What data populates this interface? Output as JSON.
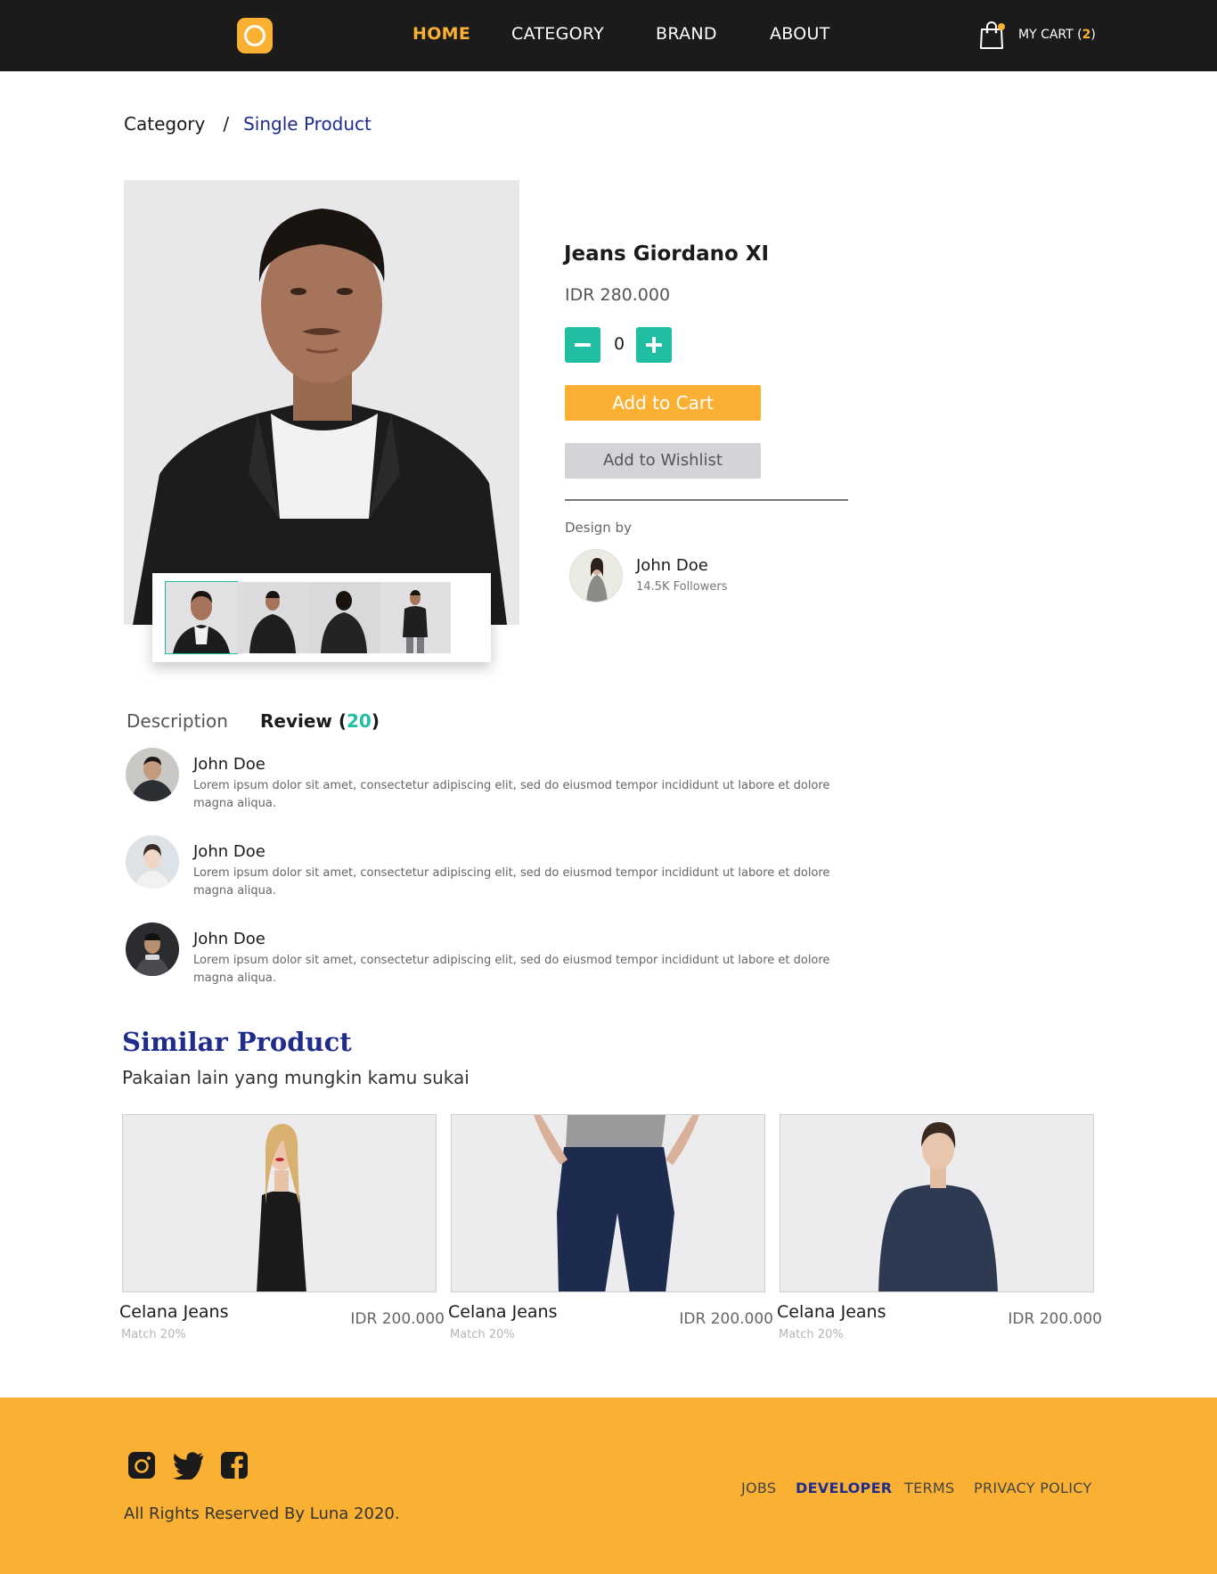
{
  "header": {
    "logo_icon": "ring-logo-icon",
    "nav": [
      {
        "label": "HOME",
        "active": true
      },
      {
        "label": "CATEGORY",
        "active": false
      },
      {
        "label": "BRAND",
        "active": false
      },
      {
        "label": "ABOUT",
        "active": false
      }
    ],
    "cart": {
      "label": "MY CART (",
      "count": "2",
      "close": ")",
      "icon": "shopping-bag-icon"
    }
  },
  "breadcrumb": {
    "parent": "Category",
    "separator": "/",
    "current": "Single Product"
  },
  "product": {
    "title": "Jeans Giordano XI",
    "price": "IDR 280.000",
    "quantity": "0",
    "minus_icon": "minus-icon",
    "plus_icon": "plus-icon",
    "add_to_cart": "Add to Cart",
    "add_to_wishlist": "Add to Wishlist",
    "design_by_label": "Design by",
    "designer": {
      "name": "John Doe",
      "followers": "14.5K Followers"
    },
    "thumbnails": [
      "thumbnail-front",
      "thumbnail-front-2",
      "thumbnail-back",
      "thumbnail-full"
    ]
  },
  "tabs": {
    "description": "Description",
    "review_label": "Review (",
    "review_count": "20",
    "review_close": ")"
  },
  "reviews": [
    {
      "name": "John Doe",
      "text": "Lorem ipsum dolor sit amet, consectetur adipiscing elit, sed do eiusmod tempor incididunt ut labore et dolore magna  aliqua."
    },
    {
      "name": "John Doe",
      "text": "Lorem ipsum dolor sit amet, consectetur adipiscing elit, sed do eiusmod tempor incididunt ut labore et dolore magna  aliqua."
    },
    {
      "name": "John Doe",
      "text": "Lorem ipsum dolor sit amet, consectetur adipiscing elit, sed do eiusmod tempor incididunt ut labore et dolore magna  aliqua."
    }
  ],
  "similar": {
    "title": "Similar Product",
    "subtitle": "Pakaian lain yang mungkin kamu sukai",
    "items": [
      {
        "name": "Celana Jeans",
        "match": "Match 20%",
        "price": "IDR 200.000"
      },
      {
        "name": "Celana Jeans",
        "match": "Match 20%",
        "price": "IDR 200.000"
      },
      {
        "name": "Celana Jeans",
        "match": "Match 20%",
        "price": "IDR 200.000"
      }
    ]
  },
  "footer": {
    "social_icons": [
      "instagram-icon",
      "twitter-icon",
      "facebook-icon"
    ],
    "copyright": "All Rights Reserved By Luna 2020.",
    "links": [
      {
        "label": "JOBS",
        "active": false
      },
      {
        "label": "DEVELOPER",
        "active": true
      },
      {
        "label": "TERMS",
        "active": false
      },
      {
        "label": "PRIVACY POLICY",
        "active": false
      }
    ]
  },
  "colors": {
    "header_bg": "#1b1b1b",
    "accent_yellow": "#f9b033",
    "accent_teal": "#20bfa3",
    "accent_navy": "#1f2c8c",
    "wishlist_gray": "#d4d4d8"
  }
}
